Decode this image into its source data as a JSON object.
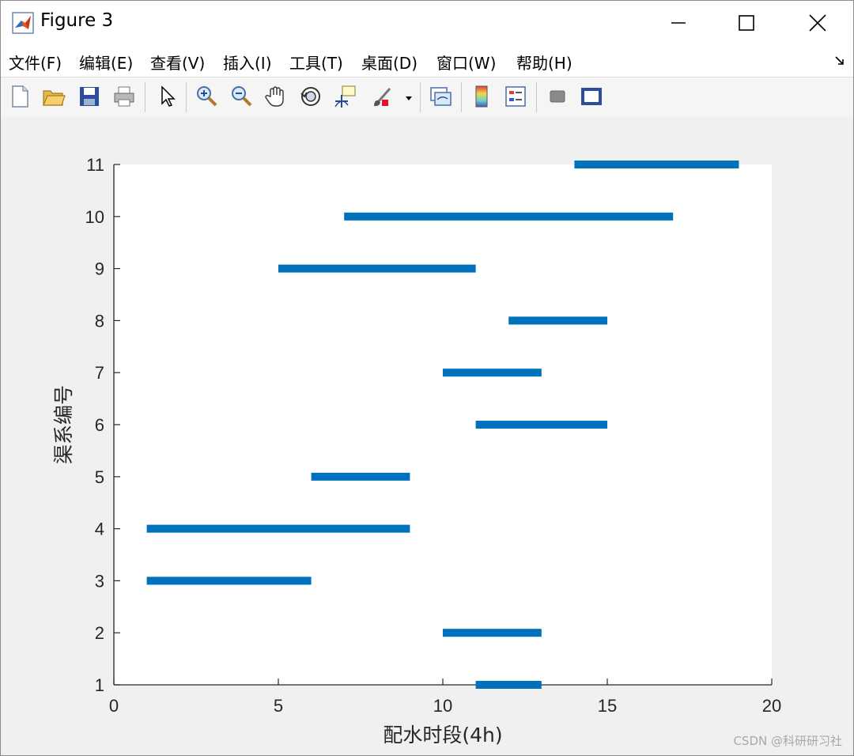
{
  "window": {
    "title": "Figure 3",
    "menu": [
      {
        "label": "文件(F)",
        "name": "menu-file"
      },
      {
        "label": "编辑(E)",
        "name": "menu-edit"
      },
      {
        "label": "查看(V)",
        "name": "menu-view"
      },
      {
        "label": "插入(I)",
        "name": "menu-insert"
      },
      {
        "label": "工具(T)",
        "name": "menu-tools"
      },
      {
        "label": "桌面(D)",
        "name": "menu-desktop"
      },
      {
        "label": "窗口(W)",
        "name": "menu-window"
      },
      {
        "label": "帮助(H)",
        "name": "menu-help"
      }
    ],
    "toolbar_icons": [
      "new-figure-icon",
      "open-file-icon",
      "save-icon",
      "print-icon",
      "pointer-icon",
      "zoom-in-icon",
      "zoom-out-icon",
      "pan-hand-icon",
      "rotate-3d-icon",
      "data-cursor-icon",
      "brush-icon",
      "link-plot-icon",
      "colorbar-icon",
      "legend-icon",
      "hide-plot-tools-icon",
      "show-plot-tools-icon"
    ]
  },
  "watermark": "CSDN @科研研习社",
  "chart_data": {
    "type": "bar",
    "orientation": "horizontal-range",
    "xlabel": "配水时段(4h)",
    "ylabel": "渠系编号",
    "xlim": [
      0,
      20
    ],
    "ylim": [
      1,
      11
    ],
    "xticks": [
      0,
      5,
      10,
      15,
      20
    ],
    "yticks": [
      1,
      2,
      3,
      4,
      5,
      6,
      7,
      8,
      9,
      10,
      11
    ],
    "grid": false,
    "bar_color": "#0072bd",
    "series": [
      {
        "values": [
          {
            "channel": 1,
            "start": 11,
            "end": 13
          },
          {
            "channel": 2,
            "start": 10,
            "end": 13
          },
          {
            "channel": 3,
            "start": 1,
            "end": 6
          },
          {
            "channel": 4,
            "start": 1,
            "end": 9
          },
          {
            "channel": 5,
            "start": 6,
            "end": 9
          },
          {
            "channel": 6,
            "start": 11,
            "end": 15
          },
          {
            "channel": 7,
            "start": 10,
            "end": 13
          },
          {
            "channel": 8,
            "start": 12,
            "end": 15
          },
          {
            "channel": 9,
            "start": 5,
            "end": 11
          },
          {
            "channel": 10,
            "start": 7,
            "end": 17
          },
          {
            "channel": 11,
            "start": 14,
            "end": 19
          }
        ]
      }
    ]
  }
}
